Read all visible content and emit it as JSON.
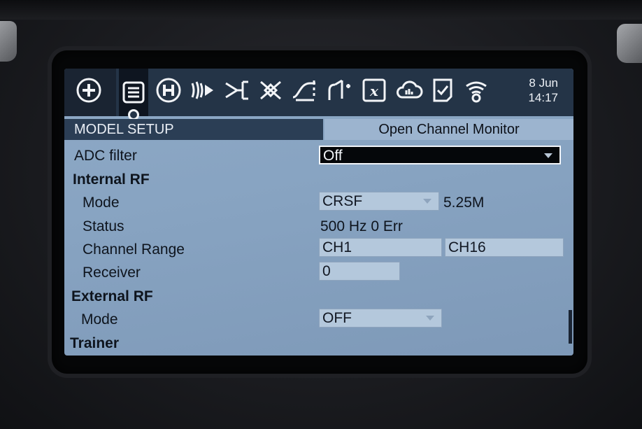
{
  "topbar": {
    "icons": [
      "add-circle-icon",
      "menu-list-icon",
      "heli-icon",
      "telemetry-waves-icon",
      "mixer-icon",
      "outputs-icon",
      "curves-icon",
      "logical-switch-icon",
      "custom-function-icon",
      "cloud-script-icon",
      "checklist-icon",
      "telemetry-icon"
    ],
    "date": "8 Jun",
    "time": "14:17"
  },
  "header": {
    "title": "MODEL SETUP",
    "monitor_button": "Open Channel Monitor"
  },
  "rows": {
    "adc_filter_label": "ADC filter",
    "adc_filter_value": "Off",
    "internal_rf_label": "Internal RF",
    "mode_label": "Mode",
    "mode_value": "CRSF",
    "mode_extra": "5.25M",
    "status_label": "Status",
    "status_value": "500 Hz 0 Err",
    "channel_range_label": "Channel Range",
    "channel_start": "CH1",
    "channel_end": "CH16",
    "receiver_label": "Receiver",
    "receiver_value": "0",
    "external_rf_label": "External RF",
    "ext_mode_label": "Mode",
    "ext_mode_value": "OFF",
    "trainer_label": "Trainer"
  },
  "colors": {
    "screen_bg": "#87a3c1",
    "topbar_bg": "#243447",
    "title_bg": "#2b3e55",
    "field_bg": "#b4c8dc",
    "selected_field_bg": "#05070a"
  }
}
